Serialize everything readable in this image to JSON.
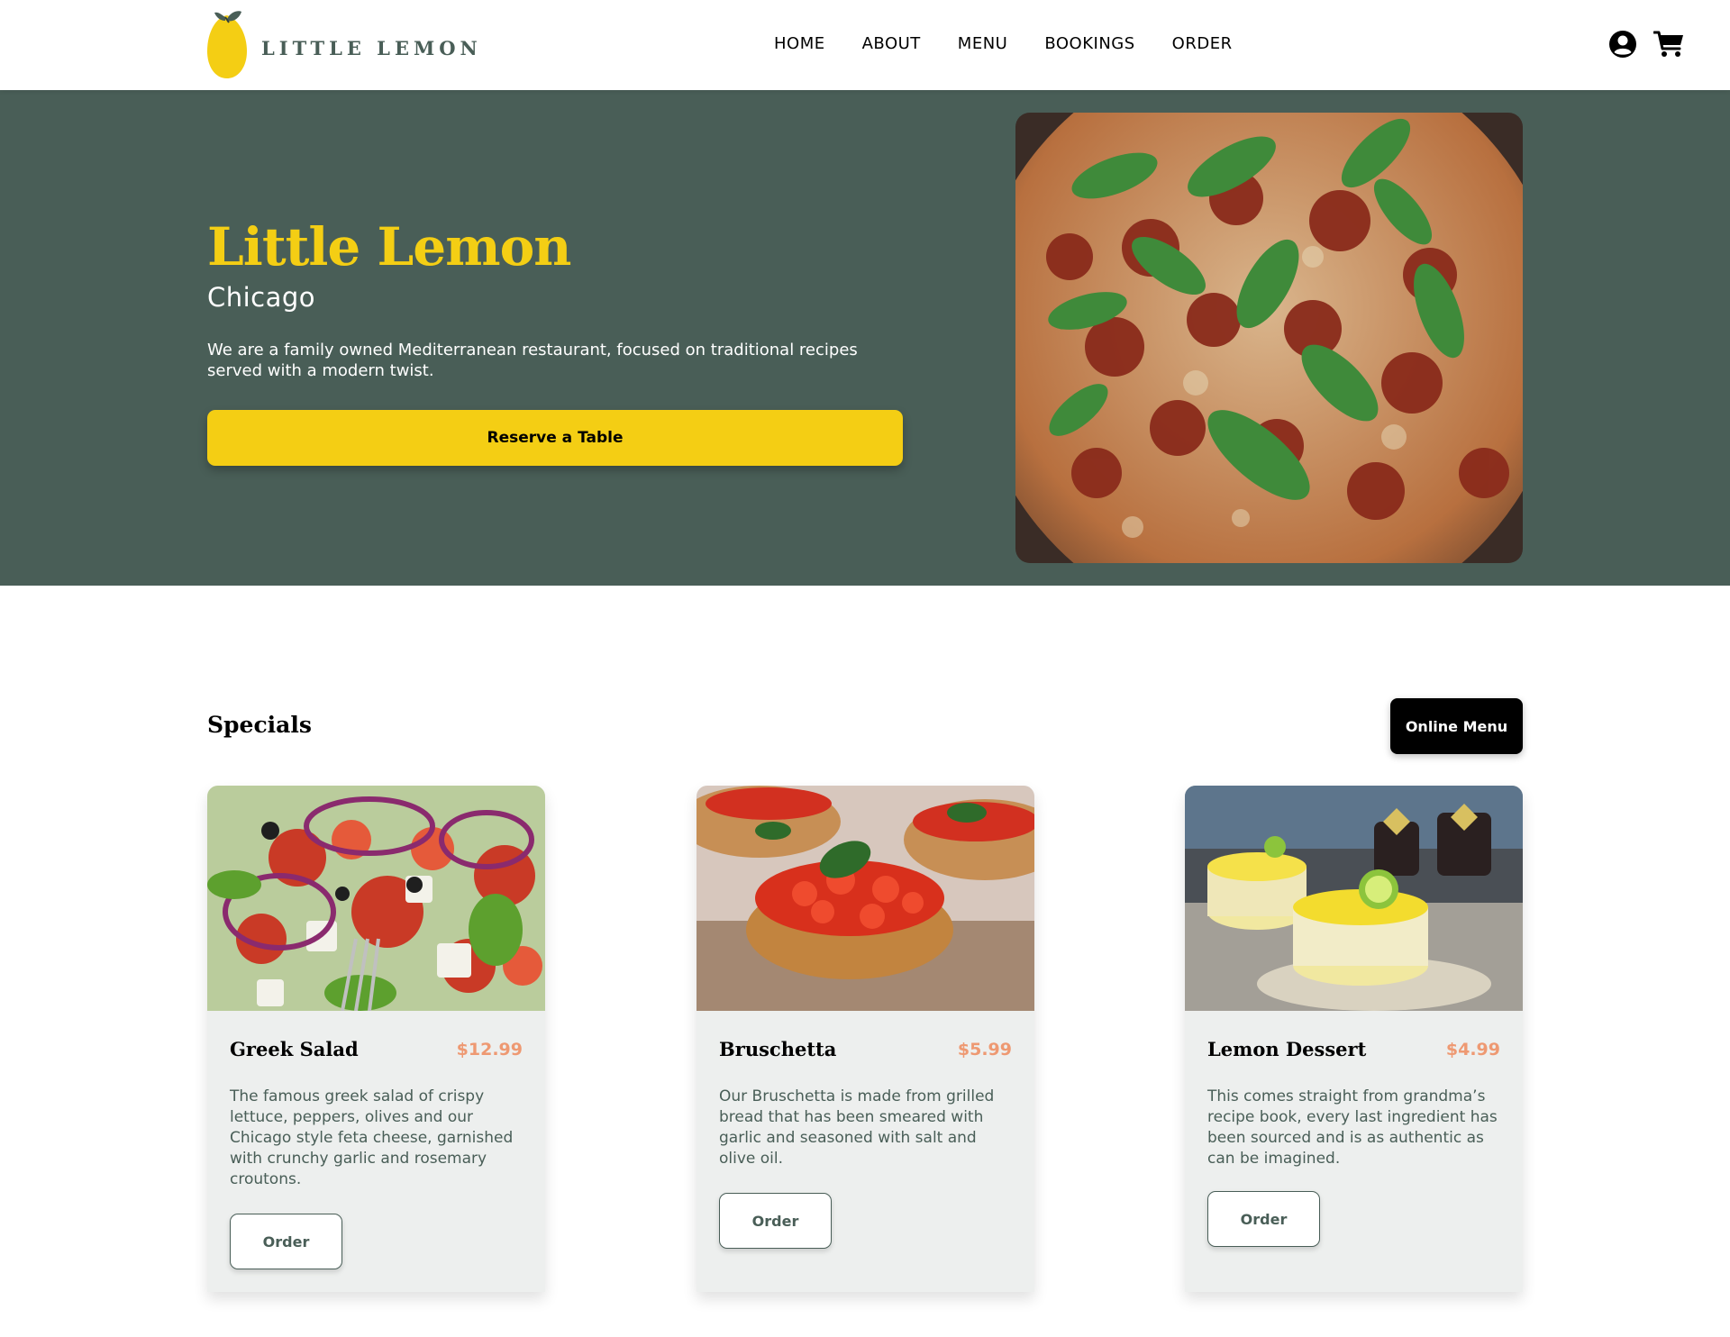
{
  "header": {
    "logo_text": "LITTLE LEMON",
    "nav": [
      "HOME",
      "ABOUT",
      "MENU",
      "BOOKINGS",
      "ORDER"
    ],
    "icons": [
      "user-icon",
      "cart-icon"
    ]
  },
  "hero": {
    "title": "Little Lemon",
    "subtitle": "Chicago",
    "description": "We are a family owned Mediterranean restaurant, focused on traditional recipes served with a modern twist.",
    "cta": "Reserve a Table"
  },
  "specials": {
    "title": "Specials",
    "online_menu": "Online Menu",
    "cards": [
      {
        "name": "Greek Salad",
        "price": "$12.99",
        "description": "The famous greek salad of crispy lettuce, peppers, olives and our Chicago style feta cheese, garnished with crunchy garlic and rosemary croutons.",
        "order": "Order"
      },
      {
        "name": "Bruschetta",
        "price": "$5.99",
        "description": "Our Bruschetta is made from grilled bread that has been smeared with garlic and seasoned with salt and olive oil.",
        "order": "Order"
      },
      {
        "name": "Lemon Dessert",
        "price": "$4.99",
        "description": "This comes straight from grandma’s recipe book, every last ingredient has been sourced and is as authentic as can be imagined.",
        "order": "Order"
      }
    ]
  },
  "colors": {
    "primary_green": "#495e57",
    "primary_yellow": "#f4ce14",
    "price_salmon": "#ee9972",
    "card_bg": "#edefee"
  }
}
